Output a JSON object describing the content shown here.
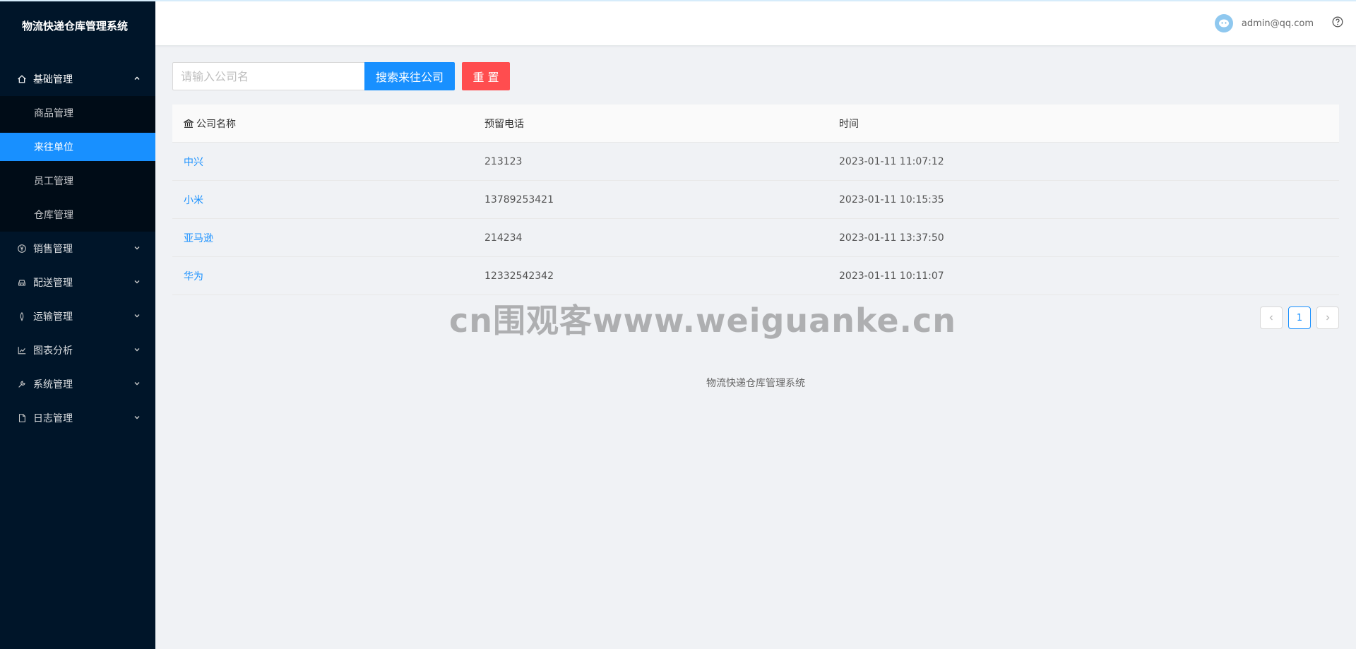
{
  "app": {
    "title": "物流快递仓库管理系统"
  },
  "sidebar": {
    "groups": [
      {
        "label": "基础管理",
        "icon": "home-icon",
        "open": true,
        "items": [
          {
            "label": "商品管理"
          },
          {
            "label": "来往单位",
            "active": true
          },
          {
            "label": "员工管理"
          },
          {
            "label": "仓库管理"
          }
        ]
      },
      {
        "label": "销售管理",
        "icon": "yen-icon"
      },
      {
        "label": "配送管理",
        "icon": "car-icon"
      },
      {
        "label": "运输管理",
        "icon": "rocket-icon"
      },
      {
        "label": "图表分析",
        "icon": "line-chart-icon"
      },
      {
        "label": "系统管理",
        "icon": "tool-icon"
      },
      {
        "label": "日志管理",
        "icon": "file-icon"
      }
    ]
  },
  "header": {
    "user": "admin@qq.com"
  },
  "search": {
    "placeholder": "请输入公司名",
    "search_label": "搜索来往公司",
    "reset_label": "重 置"
  },
  "table": {
    "columns": [
      "公司名称",
      "预留电话",
      "时间"
    ],
    "rows": [
      {
        "name": "中兴",
        "phone": "213123",
        "time": "2023-01-11 11:07:12"
      },
      {
        "name": "小米",
        "phone": "13789253421",
        "time": "2023-01-11 10:15:35"
      },
      {
        "name": "亚马逊",
        "phone": "214234",
        "time": "2023-01-11 13:37:50"
      },
      {
        "name": "华为",
        "phone": "12332542342",
        "time": "2023-01-11 10:11:07"
      }
    ]
  },
  "pagination": {
    "current": "1"
  },
  "watermark": "cn围观客www.weiguanke.cn",
  "footer": "物流快递仓库管理系统",
  "colors": {
    "sidebar": "#001529",
    "primary": "#1890ff",
    "danger": "#ff4d4f"
  }
}
